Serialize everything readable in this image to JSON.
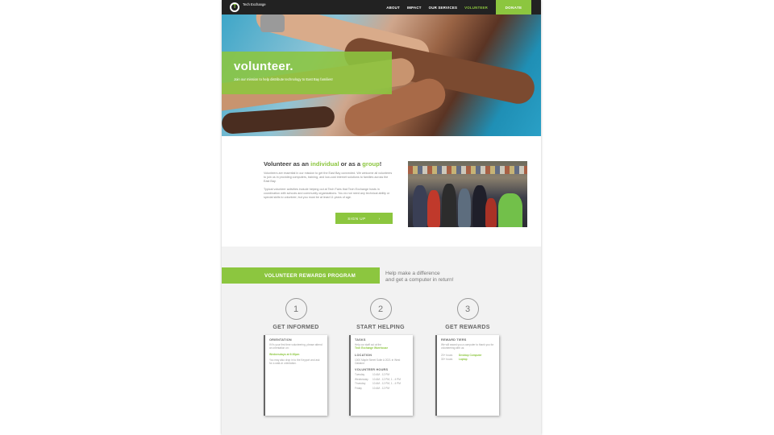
{
  "nav": {
    "logo_glyph": "T",
    "logo_text": "Tech Exchange",
    "links": [
      "ABOUT",
      "IMPACT",
      "OUR SERVICES",
      "VOLUNTEER"
    ],
    "donate": "DONATE",
    "accent_color": "#8cc63f"
  },
  "hero": {
    "title": "volunteer.",
    "subtitle": "Join our mission to help distribute technology to East Bay families!"
  },
  "intro": {
    "heading_pre": "Volunteer as an ",
    "heading_hl1": "individual",
    "heading_mid": " or as a ",
    "heading_hl2": "group",
    "heading_end": "!",
    "para1": "Volunteers are essential in our mission to get the East Bay connected. We welcome all volunteers to join us in providing computers, training, and low-cost internet solutions to families across the East Bay.",
    "para2": "Typical volunteer activities include helping out at Tech Fairs that Tech Exchange hosts in coordination with schools and community organizations. You do not need any technical ability or special skills to volunteer, but you must be at least 11 years of age.",
    "signup": "SIGN UP",
    "signup_arrow": "›"
  },
  "rewards": {
    "banner": "VOLUNTEER REWARDS PROGRAM",
    "tagline_1": "Help make a difference",
    "tagline_2": "and get a computer in return!",
    "steps": [
      {
        "num": "1",
        "title": "GET INFORMED"
      },
      {
        "num": "2",
        "title": "START HELPING"
      },
      {
        "num": "3",
        "title": "GET REWARDS"
      }
    ],
    "card1": {
      "heading": "ORIENTATION",
      "text1": "If it's your first time volunteering, please attend an orientation on:",
      "highlight": "Wednesdays at 6:30pm",
      "text2": "You may also drop in to the Keyport and ask for a walk-in orientation."
    },
    "card2": {
      "tasks_heading": "TASKS",
      "tasks_text": "Help our staff out at the",
      "tasks_hl": "Tech Exchange Warehouse",
      "location_heading": "LOCATION",
      "location_text": "1000 Maple Street Suite A 2021 in West Oakland",
      "hours_heading": "VOLUNTEER HOURS",
      "hours": [
        {
          "day": "Tuesday",
          "time": "10 AM - 12 PM"
        },
        {
          "day": "Wednesday",
          "time": "10 AM - 12 PM, 1 - 4 PM"
        },
        {
          "day": "Thursday",
          "time": "10 AM - 12 PM, 1 - 4 PM"
        },
        {
          "day": "Friday",
          "time": "10 AM - 12 PM"
        }
      ]
    },
    "card3": {
      "heading": "REWARD TIERS",
      "text": "We will award you a computer to thank you for volunteering with us:",
      "tiers": [
        {
          "hours": "20+ hours",
          "reward": "Desktop Computer"
        },
        {
          "hours": "30+ hours",
          "reward": "Laptop"
        }
      ]
    }
  }
}
